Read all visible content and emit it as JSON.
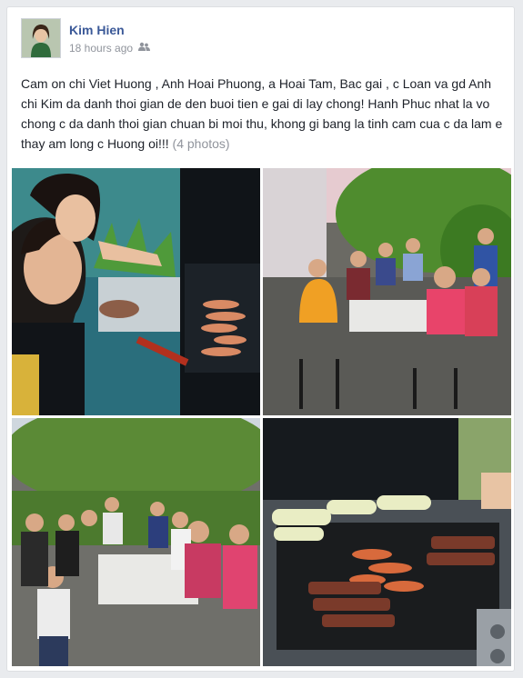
{
  "post": {
    "author": "Kim Hien",
    "timestamp": "18 hours ago",
    "audience_icon": "friends-icon",
    "text": "Cam on chi Viet Huong , Anh Hoai Phuong, a Hoai Tam, Bac gai , c Loan va gd Anh chi Kim da danh thoi gian de den buoi tien e gai di lay chong! Hanh Phuc nhat la vo chong c da danh thoi gian chuan bi moi thu, khong gi bang la tinh cam cua c da lam e thay am long c Huong oi!!! ",
    "photos_link": "(4 photos)"
  },
  "colors": {
    "link": "#3b5998",
    "meta": "#90949c",
    "text": "#1d2129",
    "card_border": "#dddfe2",
    "background": "#e9ebee"
  }
}
